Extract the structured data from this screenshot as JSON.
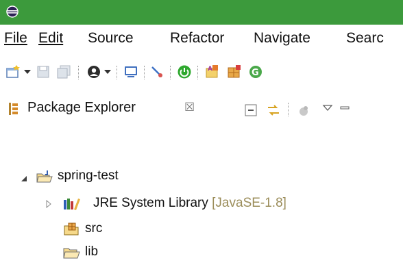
{
  "menu": {
    "items": [
      {
        "label": "File",
        "mnemonic_index": 0
      },
      {
        "label": "Edit",
        "mnemonic_index": 0
      },
      {
        "label": "Source",
        "mnemonic_index": 0
      },
      {
        "label": "Refactor",
        "mnemonic_index": 5
      },
      {
        "label": "Navigate",
        "mnemonic_index": 0
      },
      {
        "label": "Searc"
      }
    ]
  },
  "toolbar": {
    "icons": [
      "new-wizard-icon",
      "save-icon",
      "save-all-icon",
      "run-profile-icon",
      "console-icon",
      "debug-skip-icon",
      "start-server-icon",
      "open-type-icon",
      "new-package-icon",
      "refresh-icon"
    ]
  },
  "view": {
    "title": "Package Explorer",
    "close_symbol": "☒"
  },
  "tree": {
    "project": "spring-test",
    "jre_label": "JRE System Library",
    "jre_qualifier": "[JavaSE-1.8]",
    "src_label": "src",
    "lib_label": "lib"
  },
  "colors": {
    "titlebar": "#3c9a3c",
    "qualifier": "#9b8d5a",
    "folder": "#e8c55a"
  }
}
